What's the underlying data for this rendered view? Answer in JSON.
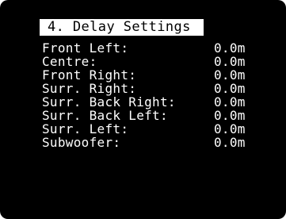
{
  "menu": {
    "title": "4. Delay Settings",
    "rows": [
      {
        "label": "Front Left:",
        "value": "0.0m"
      },
      {
        "label": "Centre:",
        "value": "0.0m"
      },
      {
        "label": "Front Right:",
        "value": "0.0m"
      },
      {
        "label": "Surr. Right:",
        "value": "0.0m"
      },
      {
        "label": "Surr. Back Right:",
        "value": "0.0m"
      },
      {
        "label": "Surr. Back Left:",
        "value": "0.0m"
      },
      {
        "label": "Surr. Left:",
        "value": "0.0m"
      },
      {
        "label": "Subwoofer:",
        "value": "0.0m"
      }
    ]
  },
  "colors": {
    "background": "#000000",
    "text": "#ffffff",
    "title_highlight": "#ffffff",
    "title_text": "#000000"
  }
}
